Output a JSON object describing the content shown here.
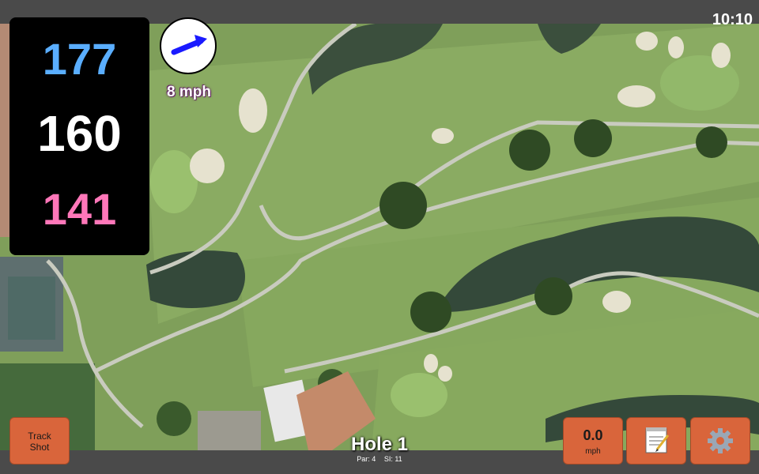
{
  "status": {
    "time": "10:10"
  },
  "yardage": {
    "back": "177",
    "middle": "160",
    "front": "141"
  },
  "wind": {
    "speed_label": "8 mph",
    "direction_icon": "arrow-right-icon"
  },
  "track_button": {
    "line1": "Track",
    "line2": "Shot"
  },
  "wind_button": {
    "value": "0.0",
    "unit": "mph"
  },
  "hole": {
    "title": "Hole 1",
    "par": "Par: 4",
    "si": "SI: 11"
  },
  "colors": {
    "back": "#5aaeff",
    "middle": "#ffffff",
    "front": "#ff77b9",
    "button": "#d9653b"
  },
  "icons": {
    "notes": "notepad-icon",
    "settings": "gear-icon"
  }
}
